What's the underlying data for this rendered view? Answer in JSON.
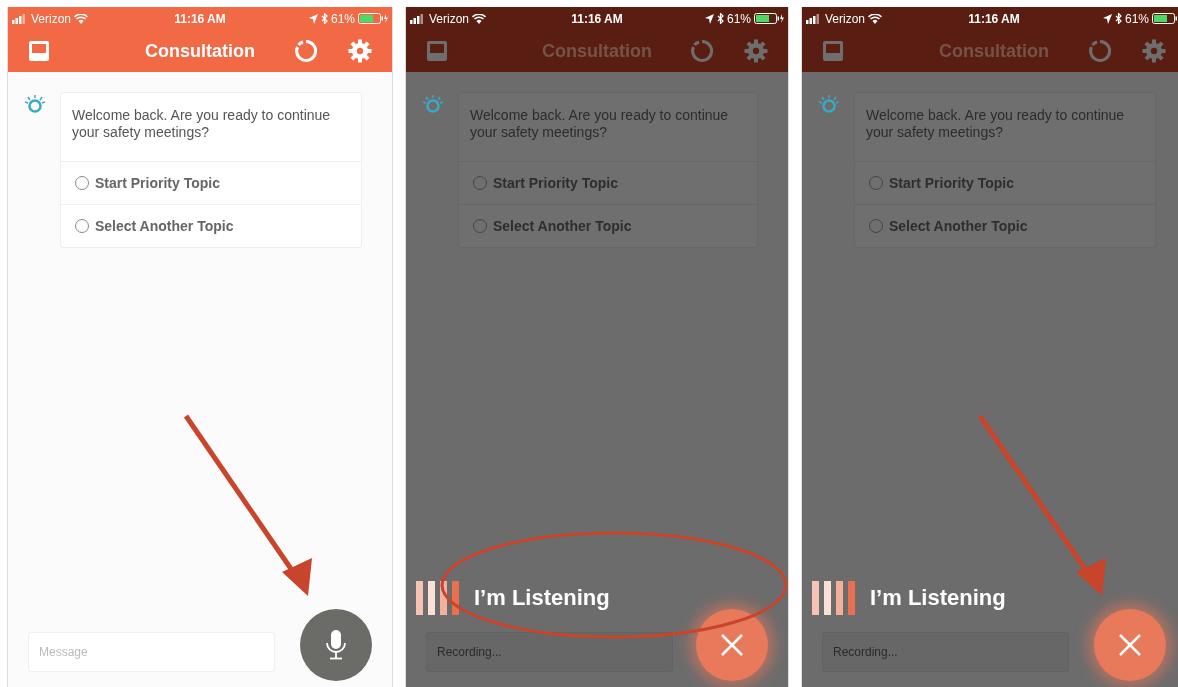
{
  "screens": [
    {
      "kind": "idle",
      "dimmed": false,
      "status_bar": {
        "carrier": "Verizon",
        "time": "11:16 AM",
        "battery": "61%"
      },
      "header": {
        "title": "Consultation"
      },
      "message": "Welcome back. Are you ready to continue your safety meetings?",
      "options": [
        {
          "label": "Start Priority Topic",
          "selected": false
        },
        {
          "label": "Select Another Topic",
          "selected": false
        }
      ],
      "input": {
        "placeholder": "Message"
      },
      "annotations": [
        {
          "kind": "arrow"
        }
      ]
    },
    {
      "kind": "listening",
      "dimmed": true,
      "status_bar": {
        "carrier": "Verizon",
        "time": "11:16 AM",
        "battery": "61%"
      },
      "header": {
        "title": "Consultation"
      },
      "message": "Welcome back. Are you ready to continue your safety meetings?",
      "options": [
        {
          "label": "Start Priority Topic",
          "selected": false
        },
        {
          "label": "Select Another Topic",
          "selected": false
        }
      ],
      "listening_label": "I’m Listening",
      "input": {
        "placeholder": "Recording..."
      },
      "annotations": [
        {
          "kind": "ellipse"
        }
      ]
    },
    {
      "kind": "listening",
      "dimmed": true,
      "status_bar": {
        "carrier": "Verizon",
        "time": "11:16 AM",
        "battery": "61%"
      },
      "header": {
        "title": "Consultation"
      },
      "message": "Welcome back. Are you ready to continue your safety meetings?",
      "options": [
        {
          "label": "Start Priority Topic",
          "selected": false
        },
        {
          "label": "Select Another Topic",
          "selected": false
        }
      ],
      "listening_label": "I’m Listening",
      "input": {
        "placeholder": "Recording..."
      },
      "annotations": [
        {
          "kind": "arrow"
        }
      ]
    }
  ]
}
